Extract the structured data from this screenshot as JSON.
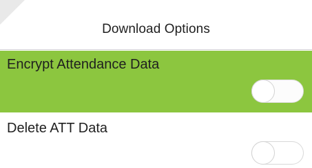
{
  "header": {
    "title": "Download Options"
  },
  "options": [
    {
      "label": "Encrypt Attendance Data",
      "selected": true,
      "toggle_on": false
    },
    {
      "label": "Delete ATT Data",
      "selected": false,
      "toggle_on": false
    }
  ],
  "colors": {
    "selected_row": "#8cc63f",
    "background": "#ffffff",
    "text": "#1f1f1f",
    "divider": "#cfcfcf"
  },
  "icons": {
    "toggle_off": "toggle-off-icon"
  }
}
